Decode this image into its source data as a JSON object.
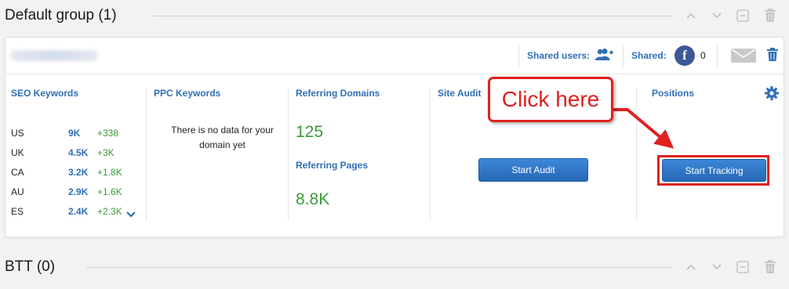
{
  "groups": [
    {
      "title": "Default group (1)"
    },
    {
      "title": "BTT (0)"
    }
  ],
  "project": {
    "shared_users_label": "Shared users:",
    "shared_label": "Shared:",
    "shared_count": "0"
  },
  "columns": {
    "seo_title": "SEO Keywords",
    "ppc_title": "PPC Keywords",
    "ref_domains_title": "Referring Domains",
    "site_audit_title": "Site Audit",
    "positions_title": "Positions"
  },
  "seo_keywords": [
    {
      "db": "US",
      "value": "9K",
      "delta": "+338"
    },
    {
      "db": "UK",
      "value": "4.5K",
      "delta": "+3K"
    },
    {
      "db": "CA",
      "value": "3.2K",
      "delta": "+1.8K"
    },
    {
      "db": "AU",
      "value": "2.9K",
      "delta": "+1.6K"
    },
    {
      "db": "ES",
      "value": "2.4K",
      "delta": "+2.3K"
    }
  ],
  "ppc": {
    "no_data_line1": "There is no data for your",
    "no_data_line2": "domain yet"
  },
  "referring": {
    "domains_value": "125",
    "pages_title": "Referring Pages",
    "pages_value": "8.8K"
  },
  "buttons": {
    "start_audit": "Start Audit",
    "start_tracking": "Start Tracking"
  },
  "annotation": {
    "callout_text": "Click here",
    "color": "#e02020"
  },
  "colors": {
    "accent_blue": "#2f6fb7",
    "positive_green": "#3a9a3a",
    "facebook": "#3b5998"
  }
}
